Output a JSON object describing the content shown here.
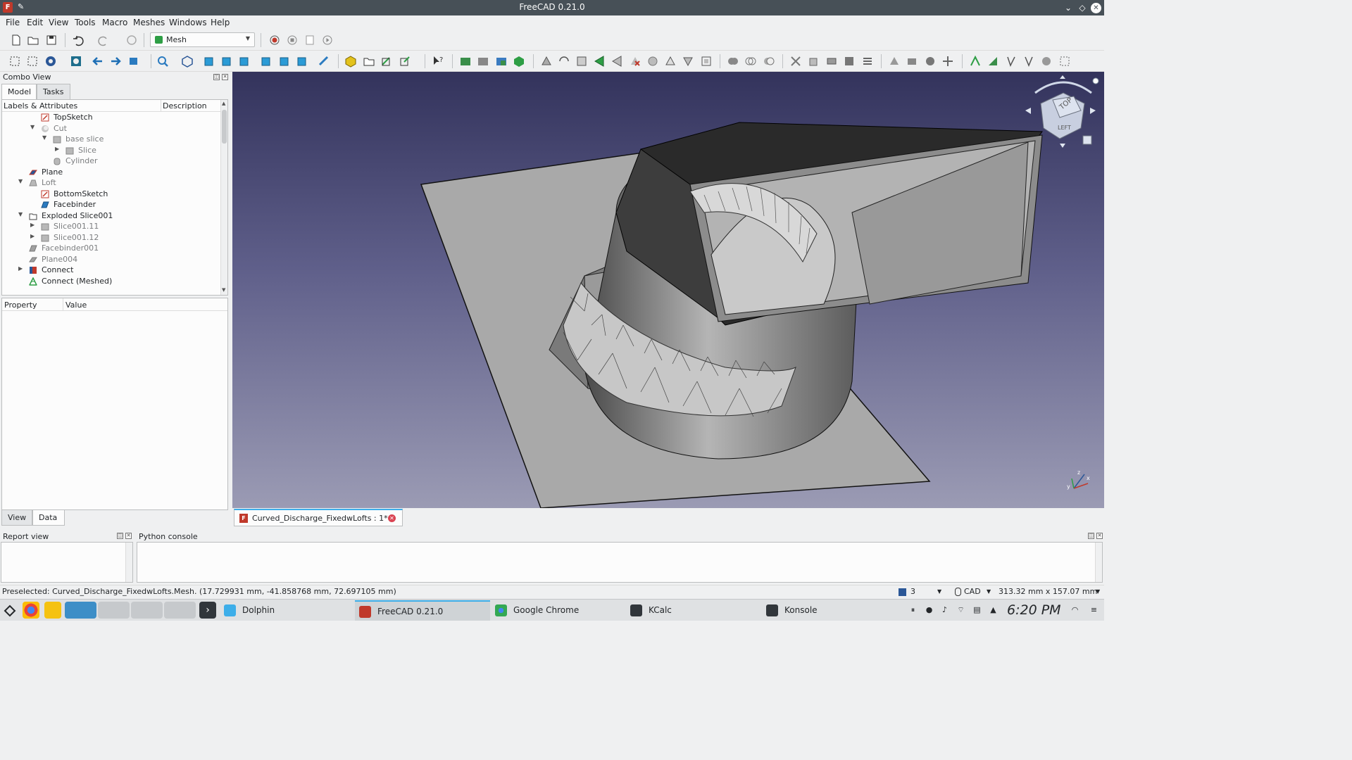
{
  "window": {
    "title": "FreeCAD 0.21.0"
  },
  "menu": [
    "File",
    "Edit",
    "View",
    "Tools",
    "Macro",
    "Meshes",
    "Windows",
    "Help"
  ],
  "toolbar": {
    "workbench": "Mesh"
  },
  "combo_view": {
    "title": "Combo View",
    "tabs": [
      "Model",
      "Tasks"
    ],
    "tree_columns": [
      "Labels & Attributes",
      "Description"
    ],
    "tree_items": [
      {
        "label": "TopSketch",
        "icon": "sketch-error-icon",
        "dim": false
      },
      {
        "label": "Cut",
        "icon": "cut-icon",
        "dim": true
      },
      {
        "label": "base slice",
        "icon": "shape-icon",
        "dim": true
      },
      {
        "label": "Slice",
        "icon": "shape-icon",
        "dim": true
      },
      {
        "label": "Cylinder",
        "icon": "cylinder-icon",
        "dim": true
      },
      {
        "label": "Plane",
        "icon": "plane-icon",
        "dim": false
      },
      {
        "label": "Loft",
        "icon": "loft-icon",
        "dim": true
      },
      {
        "label": "BottomSketch",
        "icon": "sketch-error-icon",
        "dim": false
      },
      {
        "label": "Facebinder",
        "icon": "facebinder-icon",
        "dim": false
      },
      {
        "label": "Exploded Slice001",
        "icon": "folder-icon",
        "dim": false
      },
      {
        "label": "Slice001.11",
        "icon": "shape-icon",
        "dim": true
      },
      {
        "label": "Slice001.12",
        "icon": "shape-icon",
        "dim": true
      },
      {
        "label": "Facebinder001",
        "icon": "facebinder-icon",
        "dim": true
      },
      {
        "label": "Plane004",
        "icon": "plane-icon",
        "dim": true
      },
      {
        "label": "Connect",
        "icon": "connect-icon",
        "dim": false
      },
      {
        "label": "Connect (Meshed)",
        "icon": "mesh-icon",
        "dim": false
      }
    ],
    "property_columns": [
      "Property",
      "Value"
    ],
    "property_tabs": [
      "View",
      "Data"
    ]
  },
  "document_tab": {
    "label": "Curved_Discharge_FixedwLofts : 1*"
  },
  "navigation_cube": {
    "top_face": "TOP",
    "left_face": "LEFT"
  },
  "report_view": {
    "title": "Report view"
  },
  "python_console": {
    "title": "Python console"
  },
  "status": {
    "text": "Preselected: Curved_Discharge_FixedwLofts.Mesh. (17.729931 mm, -41.858768 mm, 72.697105 mm)",
    "draw_style": "3",
    "nav_style": "CAD",
    "dimensions": "313.32 mm x 157.07 mm"
  },
  "taskbar": {
    "tasks": [
      "Dolphin",
      "FreeCAD 0.21.0",
      "Google Chrome",
      "KCalc",
      "Konsole"
    ],
    "clock": "6:20 PM"
  }
}
